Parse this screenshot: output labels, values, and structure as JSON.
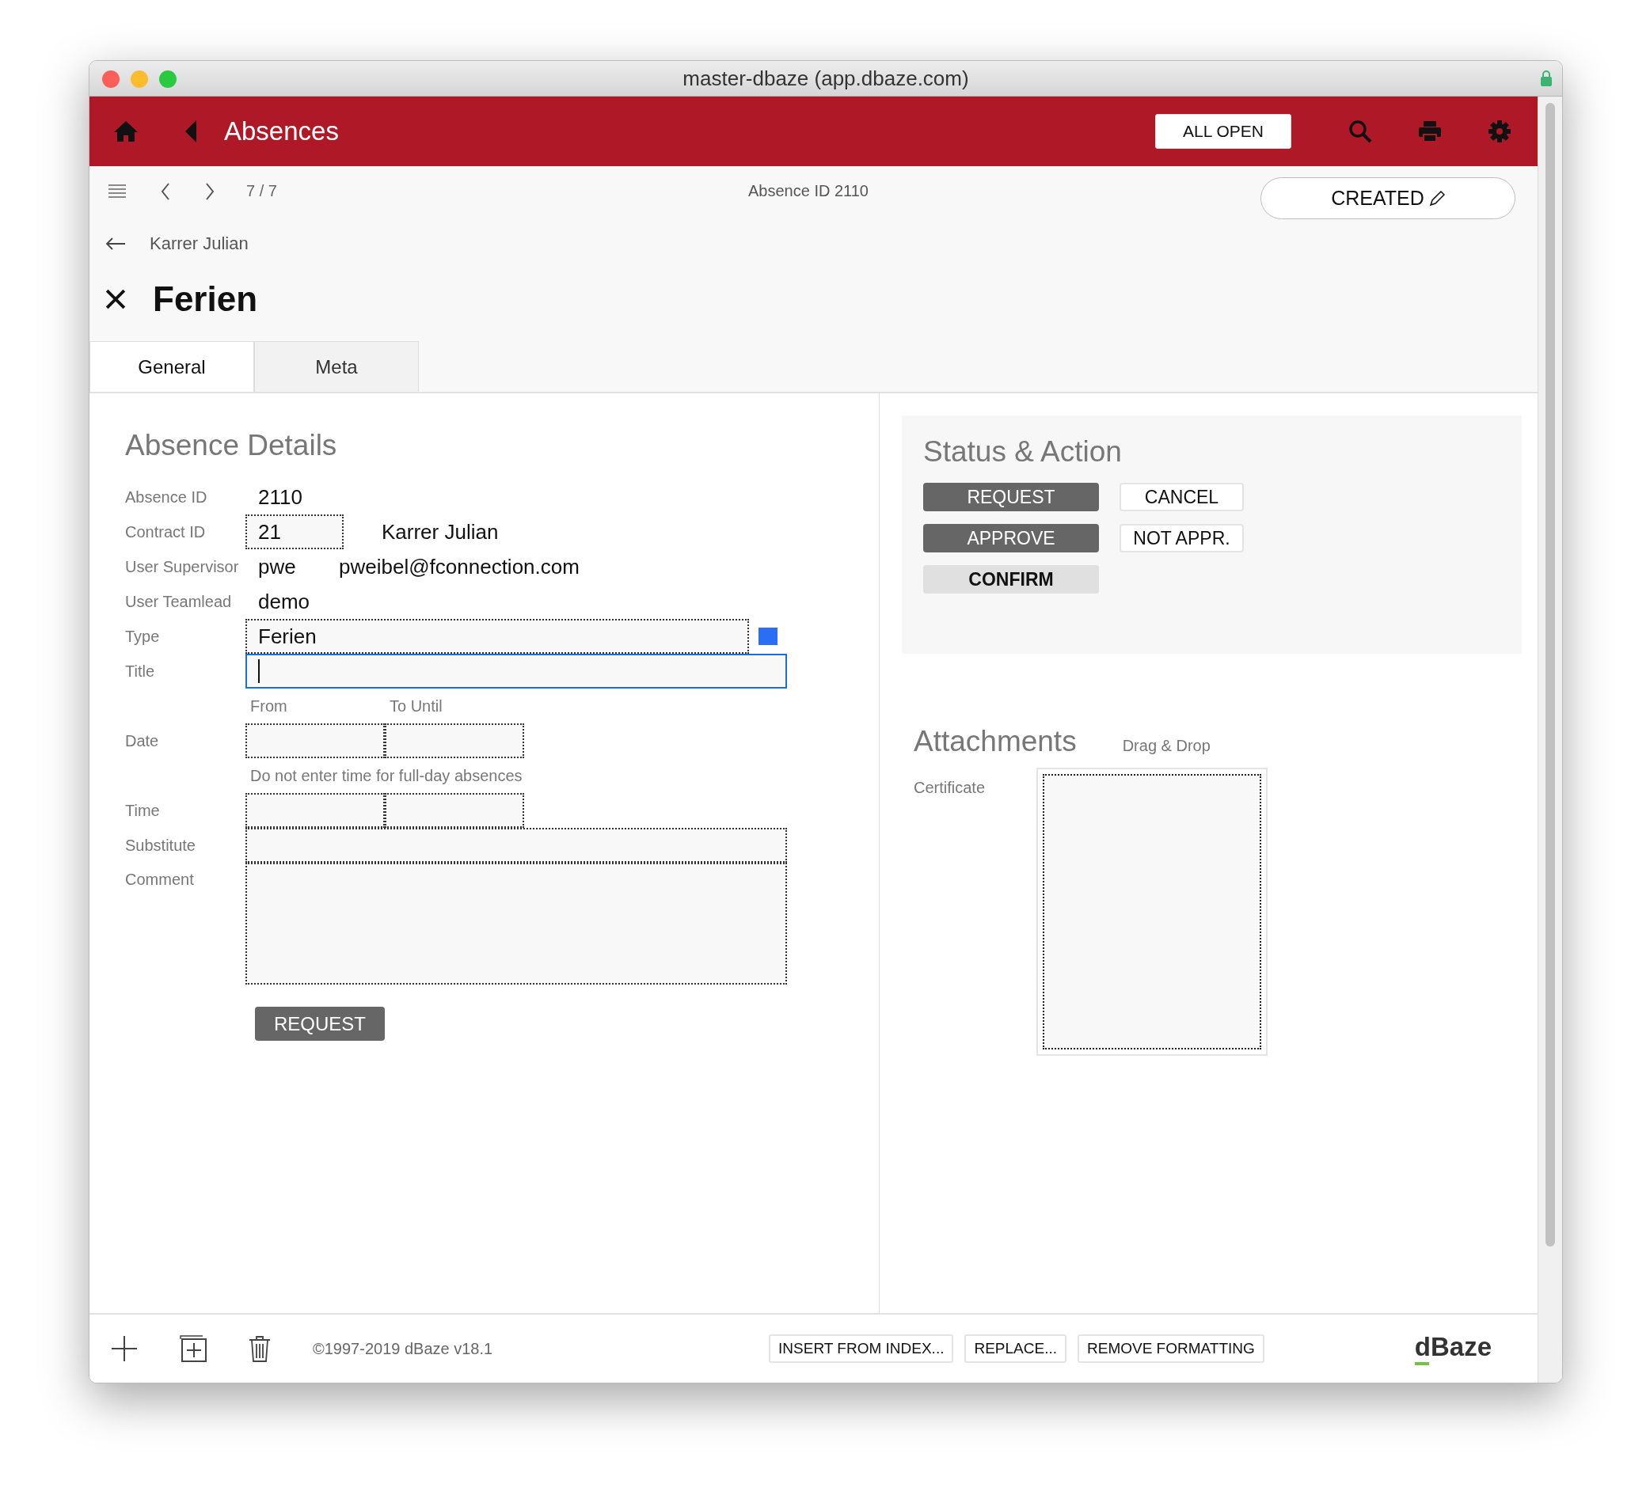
{
  "window": {
    "title": "master-dbaze (app.dbaze.com)"
  },
  "header": {
    "title": "Absences",
    "all_open_button": "ALL OPEN"
  },
  "toolbar": {
    "position": "7 / 7",
    "record_label": "Absence ID 2110",
    "status_button": "CREATED"
  },
  "breadcrumb": "Karrer Julian",
  "record_title": "Ferien",
  "tabs": [
    {
      "label": "General",
      "selected": true
    },
    {
      "label": "Meta",
      "selected": false
    }
  ],
  "details": {
    "heading": "Absence Details",
    "rows": [
      {
        "kind": "static",
        "label": "Absence ID",
        "value": "2110"
      },
      {
        "kind": "boxed",
        "label": "Contract ID",
        "value": "21",
        "extra": "Karrer Julian"
      },
      {
        "kind": "static",
        "label": "User Supervisor",
        "value": "pwe",
        "extra": "pweibel@fconnection.com"
      },
      {
        "kind": "static",
        "label": "User Teamlead",
        "value": "demo"
      },
      {
        "kind": "select",
        "label": "Type",
        "value": "Ferien"
      },
      {
        "kind": "input",
        "label": "Title",
        "focused": true
      },
      {
        "kind": "sublabels",
        "from": "From",
        "to": "To Until"
      },
      {
        "kind": "range",
        "label": "Date"
      },
      {
        "kind": "hint",
        "text": "Do not enter time for full-day absences"
      },
      {
        "kind": "range",
        "label": "Time"
      },
      {
        "kind": "input",
        "label": "Substitute",
        "focused": false
      },
      {
        "kind": "textarea",
        "label": "Comment"
      }
    ],
    "submit_button": "REQUEST"
  },
  "status": {
    "heading": "Status & Action",
    "buttons": [
      {
        "label": "REQUEST",
        "kind": "dark"
      },
      {
        "label": "CANCEL",
        "kind": "outline"
      },
      {
        "label": "APPROVE",
        "kind": "dark"
      },
      {
        "label": "NOT APPR.",
        "kind": "outline"
      },
      {
        "label": "CONFIRM",
        "kind": "light"
      }
    ]
  },
  "attachments": {
    "heading": "Attachments",
    "hint": "Drag & Drop",
    "label": "Certificate"
  },
  "footer": {
    "copyright": "©1997-2019 dBaze v18.1",
    "buttons": [
      "INSERT FROM INDEX...",
      "REPLACE...",
      "REMOVE FORMATTING"
    ],
    "logo": "dBaze"
  }
}
